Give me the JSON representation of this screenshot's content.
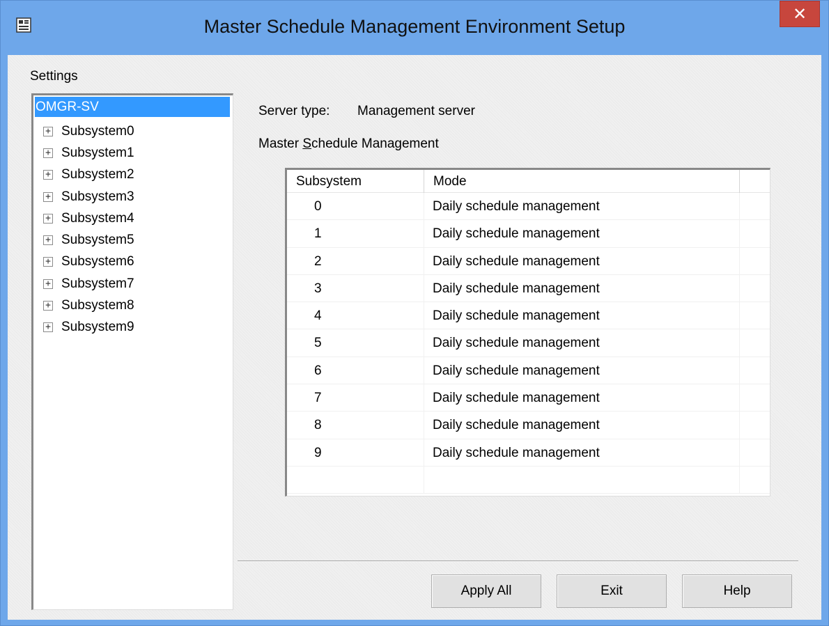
{
  "window": {
    "title": "Master Schedule Management Environment Setup",
    "close_glyph": "✕",
    "icon": "app-window-icon"
  },
  "settings": {
    "label": "Settings",
    "root": "OMGR-SV",
    "expander_glyph": "+",
    "items": [
      {
        "label": "Subsystem0"
      },
      {
        "label": "Subsystem1"
      },
      {
        "label": "Subsystem2"
      },
      {
        "label": "Subsystem3"
      },
      {
        "label": "Subsystem4"
      },
      {
        "label": "Subsystem5"
      },
      {
        "label": "Subsystem6"
      },
      {
        "label": "Subsystem7"
      },
      {
        "label": "Subsystem8"
      },
      {
        "label": "Subsystem9"
      }
    ]
  },
  "server": {
    "type_label": "Server type:",
    "type_value": "Management server"
  },
  "master": {
    "label_prefix": "Master ",
    "label_accel": "S",
    "label_rest": "chedule Management"
  },
  "table": {
    "headers": [
      "Subsystem",
      "Mode"
    ],
    "rows": [
      {
        "subsystem": "0",
        "mode": "Daily schedule management"
      },
      {
        "subsystem": "1",
        "mode": "Daily schedule management"
      },
      {
        "subsystem": "2",
        "mode": "Daily schedule management"
      },
      {
        "subsystem": "3",
        "mode": "Daily schedule management"
      },
      {
        "subsystem": "4",
        "mode": "Daily schedule management"
      },
      {
        "subsystem": "5",
        "mode": "Daily schedule management"
      },
      {
        "subsystem": "6",
        "mode": "Daily schedule management"
      },
      {
        "subsystem": "7",
        "mode": "Daily schedule management"
      },
      {
        "subsystem": "8",
        "mode": "Daily schedule management"
      },
      {
        "subsystem": "9",
        "mode": "Daily schedule management"
      }
    ]
  },
  "buttons": {
    "apply_all": "Apply All",
    "exit": "Exit",
    "help": "Help"
  },
  "colors": {
    "titlebar": "#6ea7ea",
    "selection": "#3399ff",
    "close": "#c7463d"
  }
}
